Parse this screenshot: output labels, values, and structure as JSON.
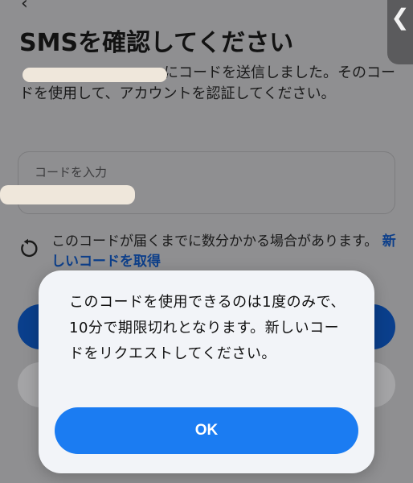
{
  "header": {
    "back_icon": "chevron-left-icon",
    "title": "SMSを確認してください",
    "side_handle_glyph": "❮"
  },
  "description": {
    "text_after_redaction": "にコードを送信しました。そのコードを使用して、アカウントを認証してください。"
  },
  "code_input": {
    "label": "コードを入力"
  },
  "resend": {
    "icon": "refresh-icon",
    "text": "このコードが届くまでに数分かかる場合があります。",
    "link": "新しいコードを取得"
  },
  "dialog": {
    "message": "このコードを使用できるのは1度のみで、10分で期限切れとなります。新しいコードをリクエストしてください。",
    "ok_label": "OK"
  },
  "colors": {
    "accent": "#1b7cf2",
    "link": "#0d3f8a",
    "redaction": "#f4ecdf"
  }
}
